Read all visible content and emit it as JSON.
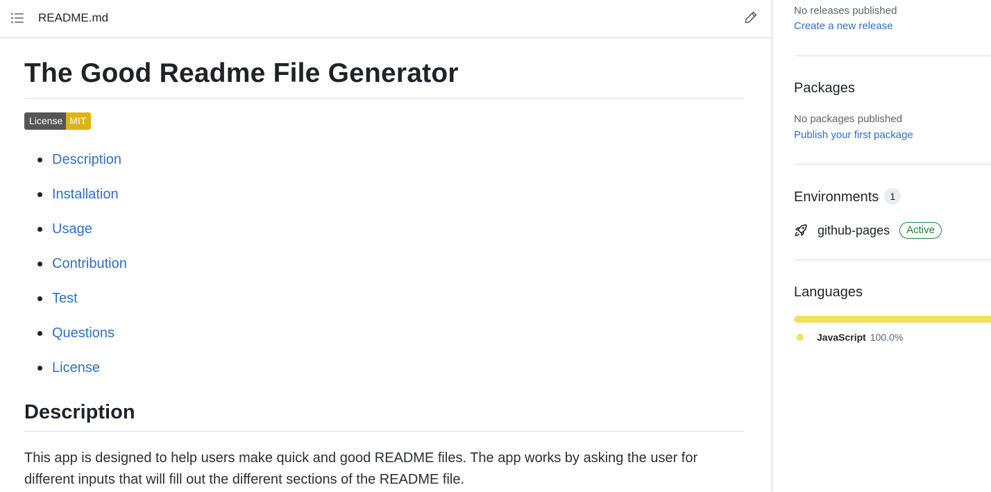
{
  "readme": {
    "file_name": "README.md",
    "title": "The Good Readme File Generator",
    "badge": {
      "label": "License",
      "value": "MIT"
    },
    "toc": [
      "Description",
      "Installation",
      "Usage",
      "Contribution",
      "Test",
      "Questions",
      "License"
    ],
    "section_heading": "Description",
    "description": "This app is designed to help users make quick and good README files. The app works by asking the user for different inputs that will fill out the different sections of the README file."
  },
  "sidebar": {
    "releases": {
      "empty_text": "No releases published",
      "link": "Create a new release"
    },
    "packages": {
      "title": "Packages",
      "empty_text": "No packages published",
      "link": "Publish your first package"
    },
    "environments": {
      "title": "Environments",
      "count": "1",
      "name": "github-pages",
      "status": "Active"
    },
    "languages": {
      "title": "Languages",
      "items": [
        {
          "name": "JavaScript",
          "percent": "100.0%",
          "color": "#f1e05a",
          "fraction": 1.0
        }
      ]
    }
  },
  "colors": {
    "link": "#2f6fc4",
    "active": "#1a7f37",
    "badge_left": "#555555",
    "badge_right": "#dfb317"
  }
}
